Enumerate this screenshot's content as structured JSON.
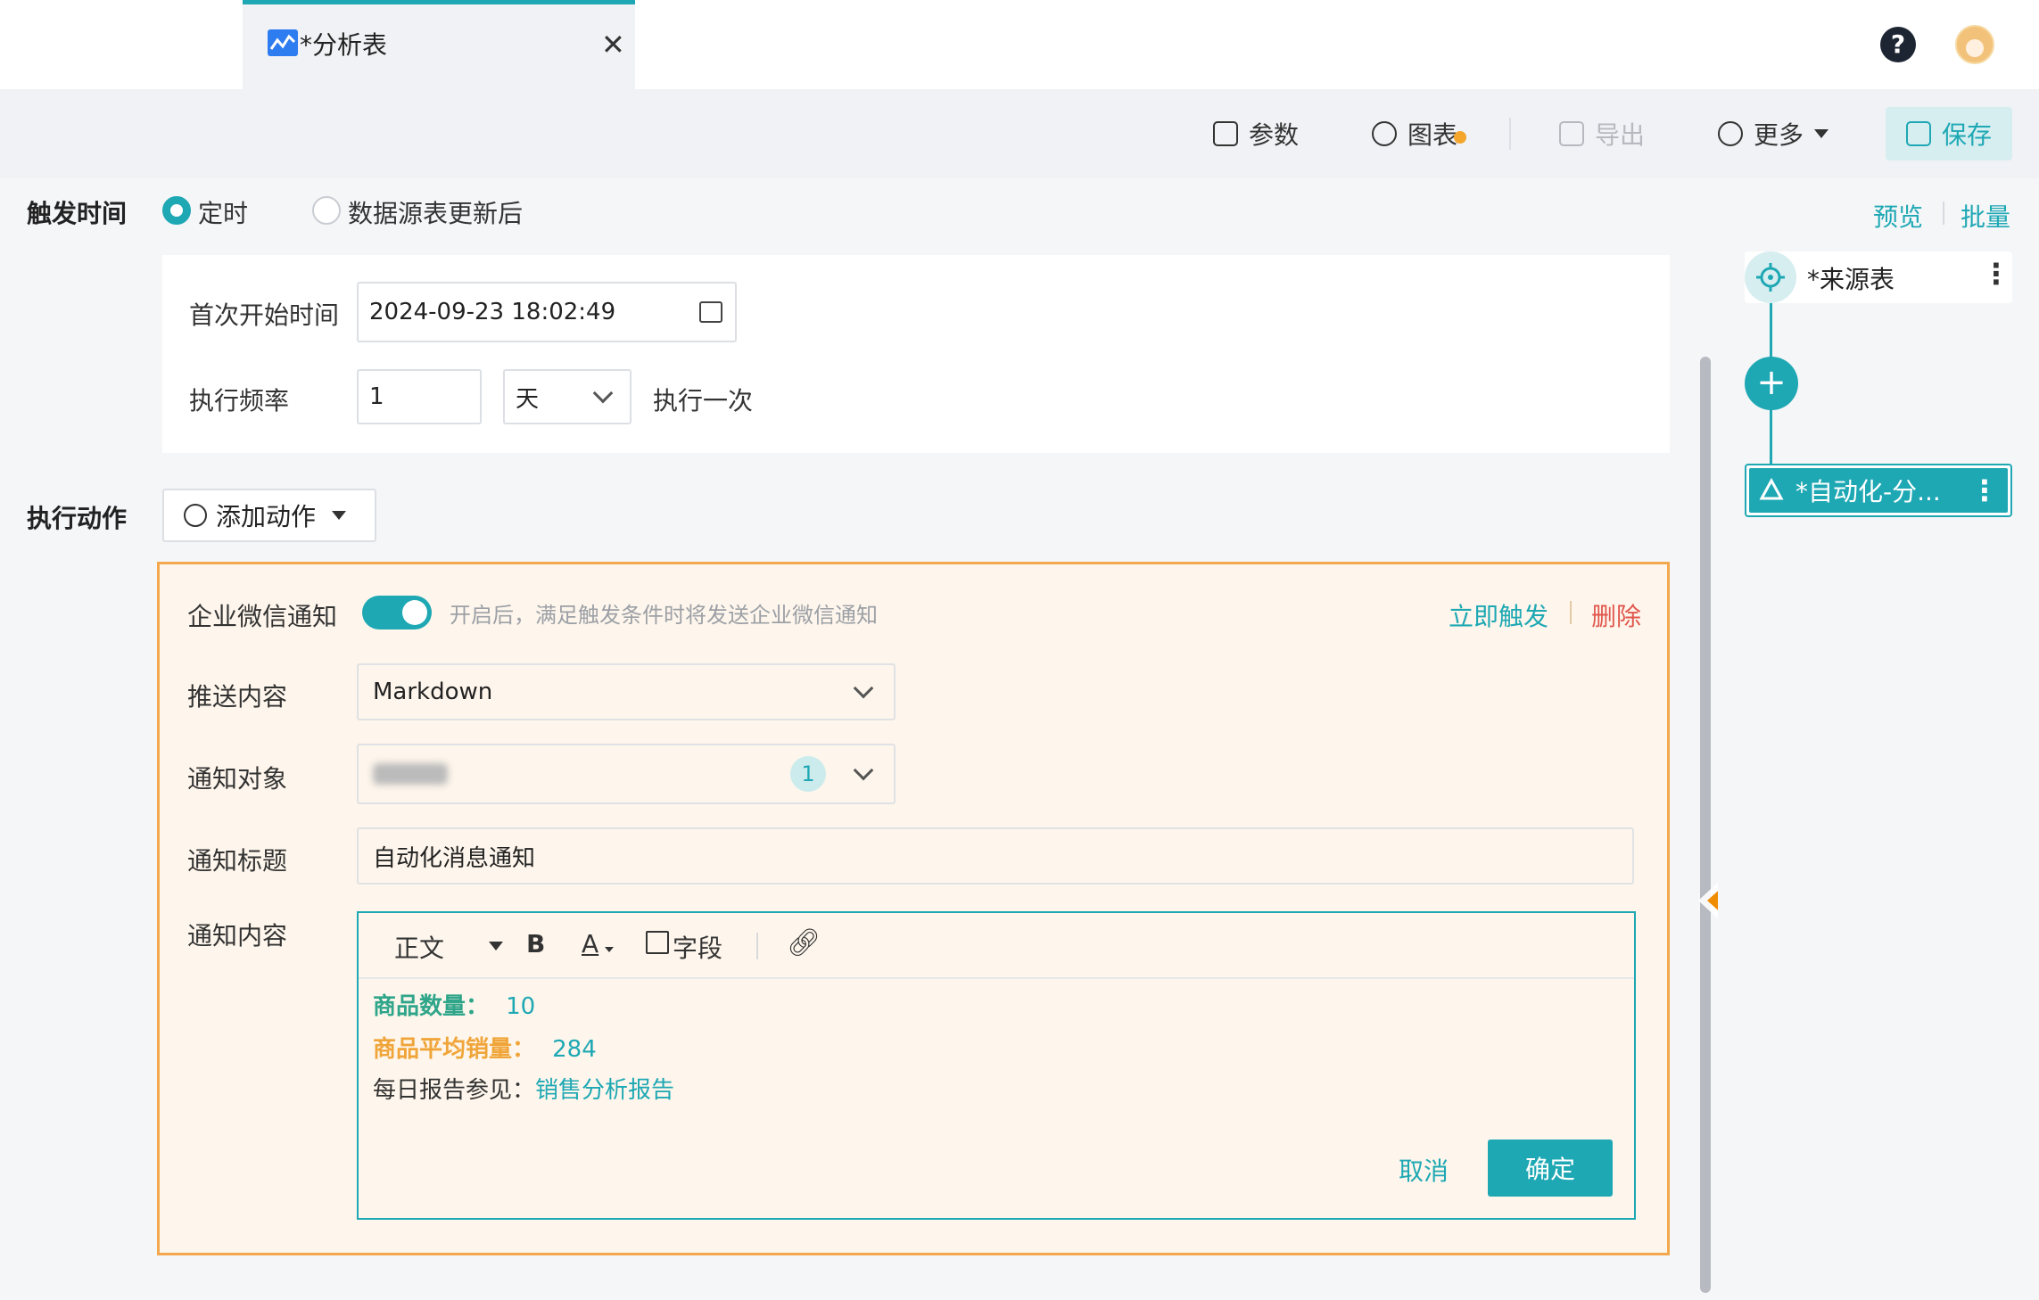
{
  "tab": {
    "title": "*分析表",
    "icon": "line-chart-icon"
  },
  "toolbar": {
    "params": "参数",
    "chart": "图表",
    "export": "导出",
    "more": "更多",
    "save": "保存"
  },
  "trigger": {
    "label": "触发时间",
    "option_scheduled": "定时",
    "option_source_update": "数据源表更新后",
    "selected": "定时",
    "first_start_label": "首次开始时间",
    "first_start_value": "2024-09-23 18:02:49",
    "frequency_label": "执行频率",
    "frequency_value": "1",
    "frequency_unit": "天",
    "frequency_suffix": "执行一次"
  },
  "actions": {
    "label": "执行动作",
    "add_action": "添加动作",
    "wechat": {
      "title": "企业微信通知",
      "enabled": true,
      "hint": "开启后，满足触发条件时将发送企业微信通知",
      "trigger_now": "立即触发",
      "delete": "删除",
      "push_content_label": "推送内容",
      "push_content_value": "Markdown",
      "target_label": "通知对象",
      "target_count": "1",
      "title_label": "通知标题",
      "title_value": "自动化消息通知",
      "content_label": "通知内容",
      "editor": {
        "style": "正文",
        "bold": "B",
        "font_color": "A",
        "field": "字段",
        "lines": [
          {
            "key": "商品数量：",
            "value": "10",
            "key_color": "#2fa58a"
          },
          {
            "key": "商品平均销量：",
            "value": "284",
            "key_color": "#f0a53a"
          }
        ],
        "report_prefix": "每日报告参见：",
        "report_link": "销售分析报告",
        "cancel": "取消",
        "confirm": "确定"
      }
    }
  },
  "side": {
    "preview": "预览",
    "batch": "批量",
    "source_node": "*来源表",
    "auto_node": "*自动化-分..."
  },
  "colors": {
    "accent": "#1ea8b4",
    "warning_border": "#f4a84e",
    "danger": "#e0574d"
  }
}
